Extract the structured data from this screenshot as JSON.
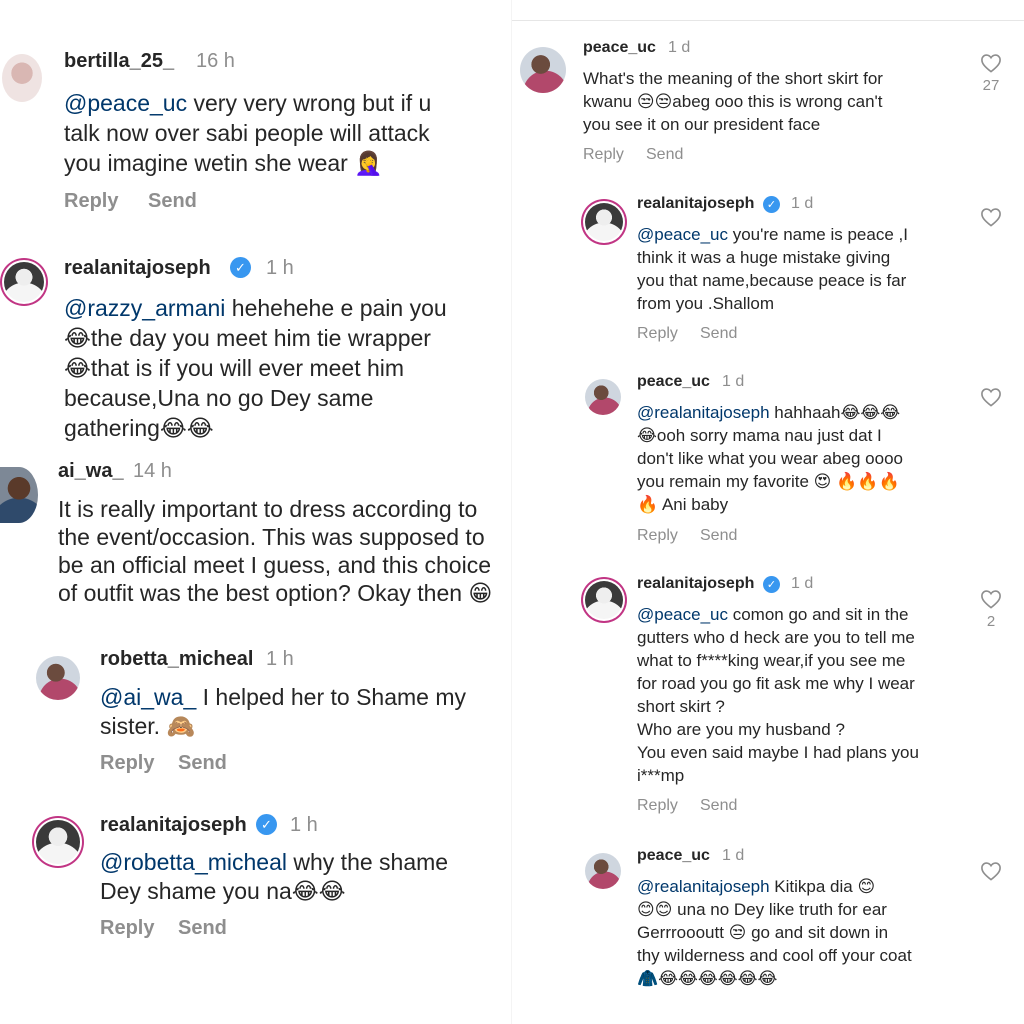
{
  "left_comments": [
    {
      "username": "bertilla_25_",
      "time": "16 h",
      "verified": false,
      "mention": "@peace_uc",
      "text": " very very wrong but if u\ntalk now over sabi people will attack\nyou imagine wetin she wear 🤦‍♀️",
      "reply": "Reply",
      "send": "Send"
    },
    {
      "username": "realanitajoseph",
      "time": "1 h",
      "verified": true,
      "mention": "@razzy_armani",
      "text": " hehehehe e pain you\n😂the day you meet him tie wrapper\n😂that is if you will ever meet him\nbecause,Una no go Dey same\ngathering😂😂"
    },
    {
      "username": "ai_wa_",
      "time": "14 h",
      "verified": false,
      "mention": "",
      "text": "It is really important to dress according to\nthe event/occasion.  This was supposed to\nbe an official meet I guess, and this choice\nof outfit was the best option? Okay then 😁"
    },
    {
      "username": "robetta_micheal",
      "time": "1 h",
      "verified": false,
      "mention": "@ai_wa_",
      "text": " I helped her to Shame my\nsister. 🙈",
      "reply": "Reply",
      "send": "Send"
    },
    {
      "username": "realanitajoseph",
      "time": "1 h",
      "verified": true,
      "mention": "@robetta_micheal",
      "text": " why the shame\nDey shame you na😂😂",
      "reply": "Reply",
      "send": "Send"
    }
  ],
  "right_comments": [
    {
      "username": "peace_uc",
      "time": "1 d",
      "verified": false,
      "mention": "",
      "text": "What's the meaning of the short skirt for\nkwanu 😒😒abeg ooo this is wrong can't\nyou see it on our president face",
      "reply": "Reply",
      "send": "Send",
      "likes": "27"
    },
    {
      "username": "realanitajoseph",
      "time": "1 d",
      "verified": true,
      "mention": "@peace_uc",
      "text": " you're name is peace ,I\nthink it was a huge mistake giving\nyou that name,because peace is far\nfrom you .Shallom",
      "reply": "Reply",
      "send": "Send",
      "likes": ""
    },
    {
      "username": "peace_uc",
      "time": "1 d",
      "verified": false,
      "mention": "@realanitajoseph",
      "text": " hahhaah😂😂😂\n😂ooh sorry mama nau just dat I\ndon't like what you wear abeg oooo\nyou remain my favorite 😍 🔥🔥🔥\n🔥 Ani baby",
      "reply": "Reply",
      "send": "Send",
      "likes": ""
    },
    {
      "username": "realanitajoseph",
      "time": "1 d",
      "verified": true,
      "mention": "@peace_uc",
      "text": " comon go and sit in the\ngutters who d heck are you to tell me\nwhat to f****king wear,if you see me\nfor road you go fit ask me why I wear\nshort skirt ?\nWho are you my husband ?\nYou even said maybe I had plans you\ni***mp",
      "reply": "Reply",
      "send": "Send",
      "likes": "2"
    },
    {
      "username": "peace_uc",
      "time": "1 d",
      "verified": false,
      "mention": "@realanitajoseph",
      "text": " Kitikpa dia 😊\n😊😊 una no Dey like truth for ear\nGerrroooutt 😒 go and sit down in\nthy wilderness and cool off your coat\n🧥😂😂😂😂😂😂",
      "likes": ""
    }
  ],
  "icons": {
    "heart": "heart-outline-icon",
    "verified": "verified-badge-icon"
  },
  "colors": {
    "text": "#262626",
    "muted": "#8e8e8e",
    "mention": "#00376b",
    "verified": "#3897f0",
    "story_ring": "#c13584"
  }
}
